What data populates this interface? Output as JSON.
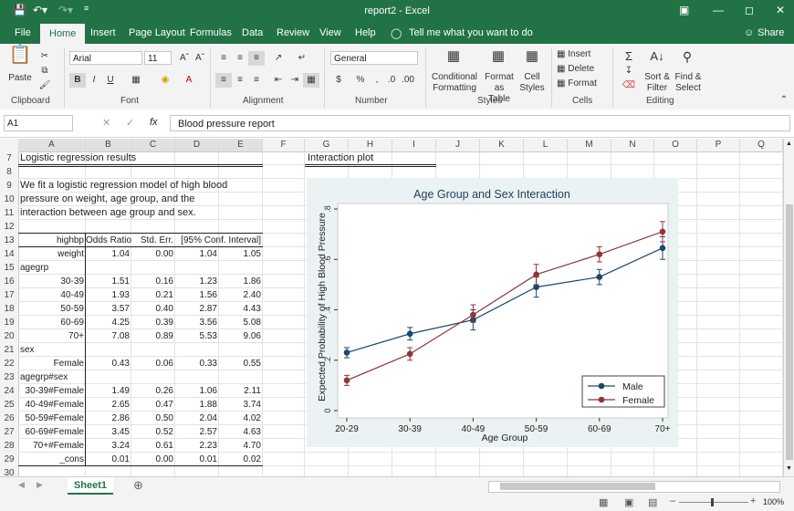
{
  "window": {
    "title": "report2  -  Excel"
  },
  "tabs": [
    "File",
    "Home",
    "Insert",
    "Page Layout",
    "Formulas",
    "Data",
    "Review",
    "View",
    "Help"
  ],
  "tell_me": "Tell me what you want to do",
  "share": "Share",
  "ribbon": {
    "paste": "Paste",
    "font_name": "Arial",
    "font_size": "11",
    "number_format": "General",
    "conditional": [
      "Conditional",
      "Formatting"
    ],
    "format_table": [
      "Format as",
      "Table"
    ],
    "cell_styles": [
      "Cell",
      "Styles"
    ],
    "insert": "Insert",
    "delete": "Delete",
    "format": "Format",
    "sort_filter": [
      "Sort &",
      "Filter"
    ],
    "find_select": [
      "Find &",
      "Select"
    ],
    "groups": [
      "Clipboard",
      "Font",
      "Alignment",
      "Number",
      "Styles",
      "Cells",
      "Editing"
    ]
  },
  "formula_bar": {
    "name_box": "A1",
    "fx": "fx",
    "content": "Blood pressure report"
  },
  "columns": [
    "A",
    "B",
    "C",
    "D",
    "E",
    "F",
    "G",
    "H",
    "I",
    "J",
    "K",
    "L",
    "M",
    "N",
    "O",
    "P",
    "Q"
  ],
  "rows": [
    "7",
    "8",
    "9",
    "10",
    "11",
    "12",
    "13",
    "14",
    "15",
    "16",
    "17",
    "18",
    "19",
    "20",
    "21",
    "22",
    "23",
    "24",
    "25",
    "26",
    "27",
    "28",
    "29",
    "30"
  ],
  "cells": {
    "heading_results": "Logistic regression results",
    "heading_plot": "Interaction plot",
    "para": [
      "We fit a logistic regression model of high blood",
      "pressure on weight, age group, and the",
      "interaction between age group and sex."
    ],
    "table_header": [
      "highbp",
      "Odds Ratio",
      "Std. Err.",
      "[95% Conf. Interval]"
    ],
    "table_rows": [
      [
        "weight",
        "1.04",
        "0.00",
        "1.04",
        "1.05"
      ],
      [
        "agegrp",
        "",
        "",
        "",
        ""
      ],
      [
        "30-39",
        "1.51",
        "0.16",
        "1.23",
        "1.86"
      ],
      [
        "40-49",
        "1.93",
        "0.21",
        "1.56",
        "2.40"
      ],
      [
        "50-59",
        "3.57",
        "0.40",
        "2.87",
        "4.43"
      ],
      [
        "60-69",
        "4.25",
        "0.39",
        "3.56",
        "5.08"
      ],
      [
        "70+",
        "7.08",
        "0.89",
        "5.53",
        "9.06"
      ],
      [
        "sex",
        "",
        "",
        "",
        ""
      ],
      [
        "Female",
        "0.43",
        "0.06",
        "0.33",
        "0.55"
      ],
      [
        "agegrp#sex",
        "",
        "",
        "",
        ""
      ],
      [
        "30-39#Female",
        "1.49",
        "0.26",
        "1.06",
        "2.11"
      ],
      [
        "40-49#Female",
        "2.65",
        "0.47",
        "1.88",
        "3.74"
      ],
      [
        "50-59#Female",
        "2.86",
        "0.50",
        "2.04",
        "4.02"
      ],
      [
        "60-69#Female",
        "3.45",
        "0.52",
        "2.57",
        "4.63"
      ],
      [
        "70+#Female",
        "3.24",
        "0.61",
        "2.23",
        "4.70"
      ],
      [
        "_cons",
        "0.01",
        "0.00",
        "0.01",
        "0.02"
      ]
    ]
  },
  "chart_data": {
    "type": "line",
    "title": "Age Group and Sex Interaction",
    "xlabel": "Age Group",
    "ylabel": "Expected Probability of High Blood Pressure",
    "categories": [
      "20-29",
      "30-39",
      "40-49",
      "50-59",
      "60-69",
      "70+"
    ],
    "yticks": [
      "0",
      ".2",
      ".4",
      ".6",
      ".8"
    ],
    "ylim": [
      0,
      0.8
    ],
    "legend_position": "bottom-right",
    "series": [
      {
        "name": "Male",
        "color": "#1a476f",
        "values": [
          0.23,
          0.305,
          0.36,
          0.49,
          0.53,
          0.645
        ],
        "ci": [
          [
            0.21,
            0.25
          ],
          [
            0.28,
            0.33
          ],
          [
            0.32,
            0.4
          ],
          [
            0.45,
            0.53
          ],
          [
            0.5,
            0.56
          ],
          [
            0.6,
            0.69
          ]
        ]
      },
      {
        "name": "Female",
        "color": "#90353b",
        "values": [
          0.12,
          0.225,
          0.38,
          0.54,
          0.62,
          0.71
        ],
        "ci": [
          [
            0.1,
            0.14
          ],
          [
            0.2,
            0.25
          ],
          [
            0.35,
            0.42
          ],
          [
            0.5,
            0.58
          ],
          [
            0.59,
            0.65
          ],
          [
            0.67,
            0.75
          ]
        ]
      }
    ]
  },
  "sheet_tab": "Sheet1",
  "zoom": "100%"
}
